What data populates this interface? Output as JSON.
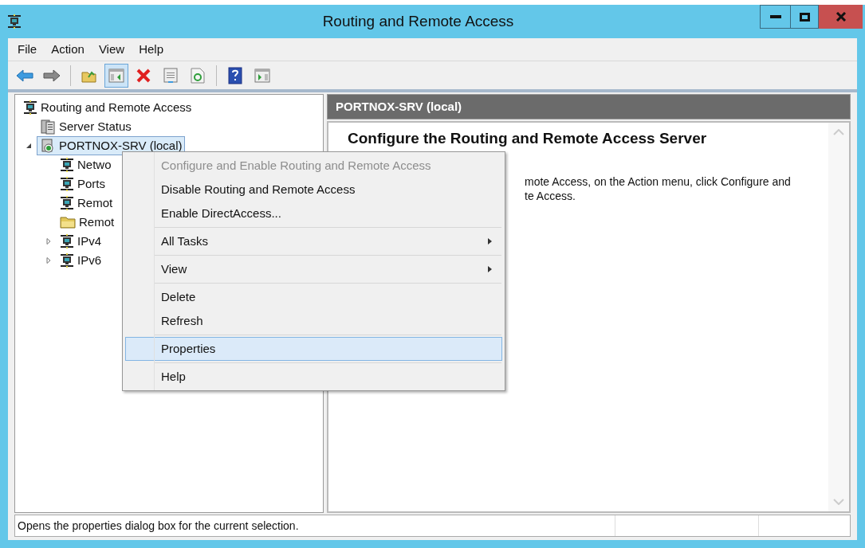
{
  "window": {
    "title": "Routing and Remote Access"
  },
  "menu_bar": [
    "File",
    "Action",
    "View",
    "Help"
  ],
  "toolbar": [
    {
      "kind": "back",
      "pressed": false
    },
    {
      "kind": "forward",
      "pressed": false
    },
    {
      "kind": "sep"
    },
    {
      "kind": "up",
      "pressed": false
    },
    {
      "kind": "tree",
      "pressed": true
    },
    {
      "kind": "delete",
      "pressed": false
    },
    {
      "kind": "properties",
      "pressed": false
    },
    {
      "kind": "refresh",
      "pressed": false
    },
    {
      "kind": "sep"
    },
    {
      "kind": "help",
      "pressed": false
    },
    {
      "kind": "action",
      "pressed": false
    }
  ],
  "tree": [
    {
      "label": "Routing and Remote Access",
      "kind": "network",
      "selected": false,
      "children": [
        {
          "label": "Server Status",
          "kind": "server",
          "selected": false
        },
        {
          "label": "PORTNOX-SRV (local)",
          "kind": "local",
          "selected": true,
          "expanded": true,
          "children": [
            {
              "label": "Netwo",
              "kind": "network",
              "selected": false
            },
            {
              "label": "Ports",
              "kind": "network",
              "selected": false
            },
            {
              "label": "Remot",
              "kind": "network",
              "selected": false
            },
            {
              "label": "Remot",
              "kind": "folder",
              "selected": false
            },
            {
              "label": "IPv4",
              "kind": "network",
              "selected": false,
              "expanded": false
            },
            {
              "label": "IPv6",
              "kind": "network",
              "selected": false,
              "expanded": false
            }
          ]
        }
      ]
    }
  ],
  "details": {
    "header": "PORTNOX-SRV (local)",
    "heading": "Configure the Routing and Remote Access Server",
    "text_lines": [
      "mote Access, on the Action menu, click Configure and",
      "te Access."
    ]
  },
  "context_menu": [
    {
      "kind": "item",
      "label": "Configure and Enable Routing and Remote Access",
      "disabled": true,
      "selected": false
    },
    {
      "kind": "item",
      "label": "Disable Routing and Remote Access",
      "disabled": false,
      "selected": false
    },
    {
      "kind": "item",
      "label": "Enable DirectAccess...",
      "disabled": false,
      "selected": false
    },
    {
      "kind": "sep"
    },
    {
      "kind": "submenu",
      "label": "All Tasks",
      "disabled": false,
      "selected": false
    },
    {
      "kind": "sep"
    },
    {
      "kind": "submenu",
      "label": "View",
      "disabled": false,
      "selected": false
    },
    {
      "kind": "sep"
    },
    {
      "kind": "item",
      "label": "Delete",
      "disabled": false,
      "selected": false
    },
    {
      "kind": "item",
      "label": "Refresh",
      "disabled": false,
      "selected": false
    },
    {
      "kind": "sep"
    },
    {
      "kind": "item",
      "label": "Properties",
      "disabled": false,
      "selected": true
    },
    {
      "kind": "sep"
    },
    {
      "kind": "item",
      "label": "Help",
      "disabled": false,
      "selected": false
    }
  ],
  "status_bar": {
    "text": "Opens the properties dialog box for the current selection."
  }
}
